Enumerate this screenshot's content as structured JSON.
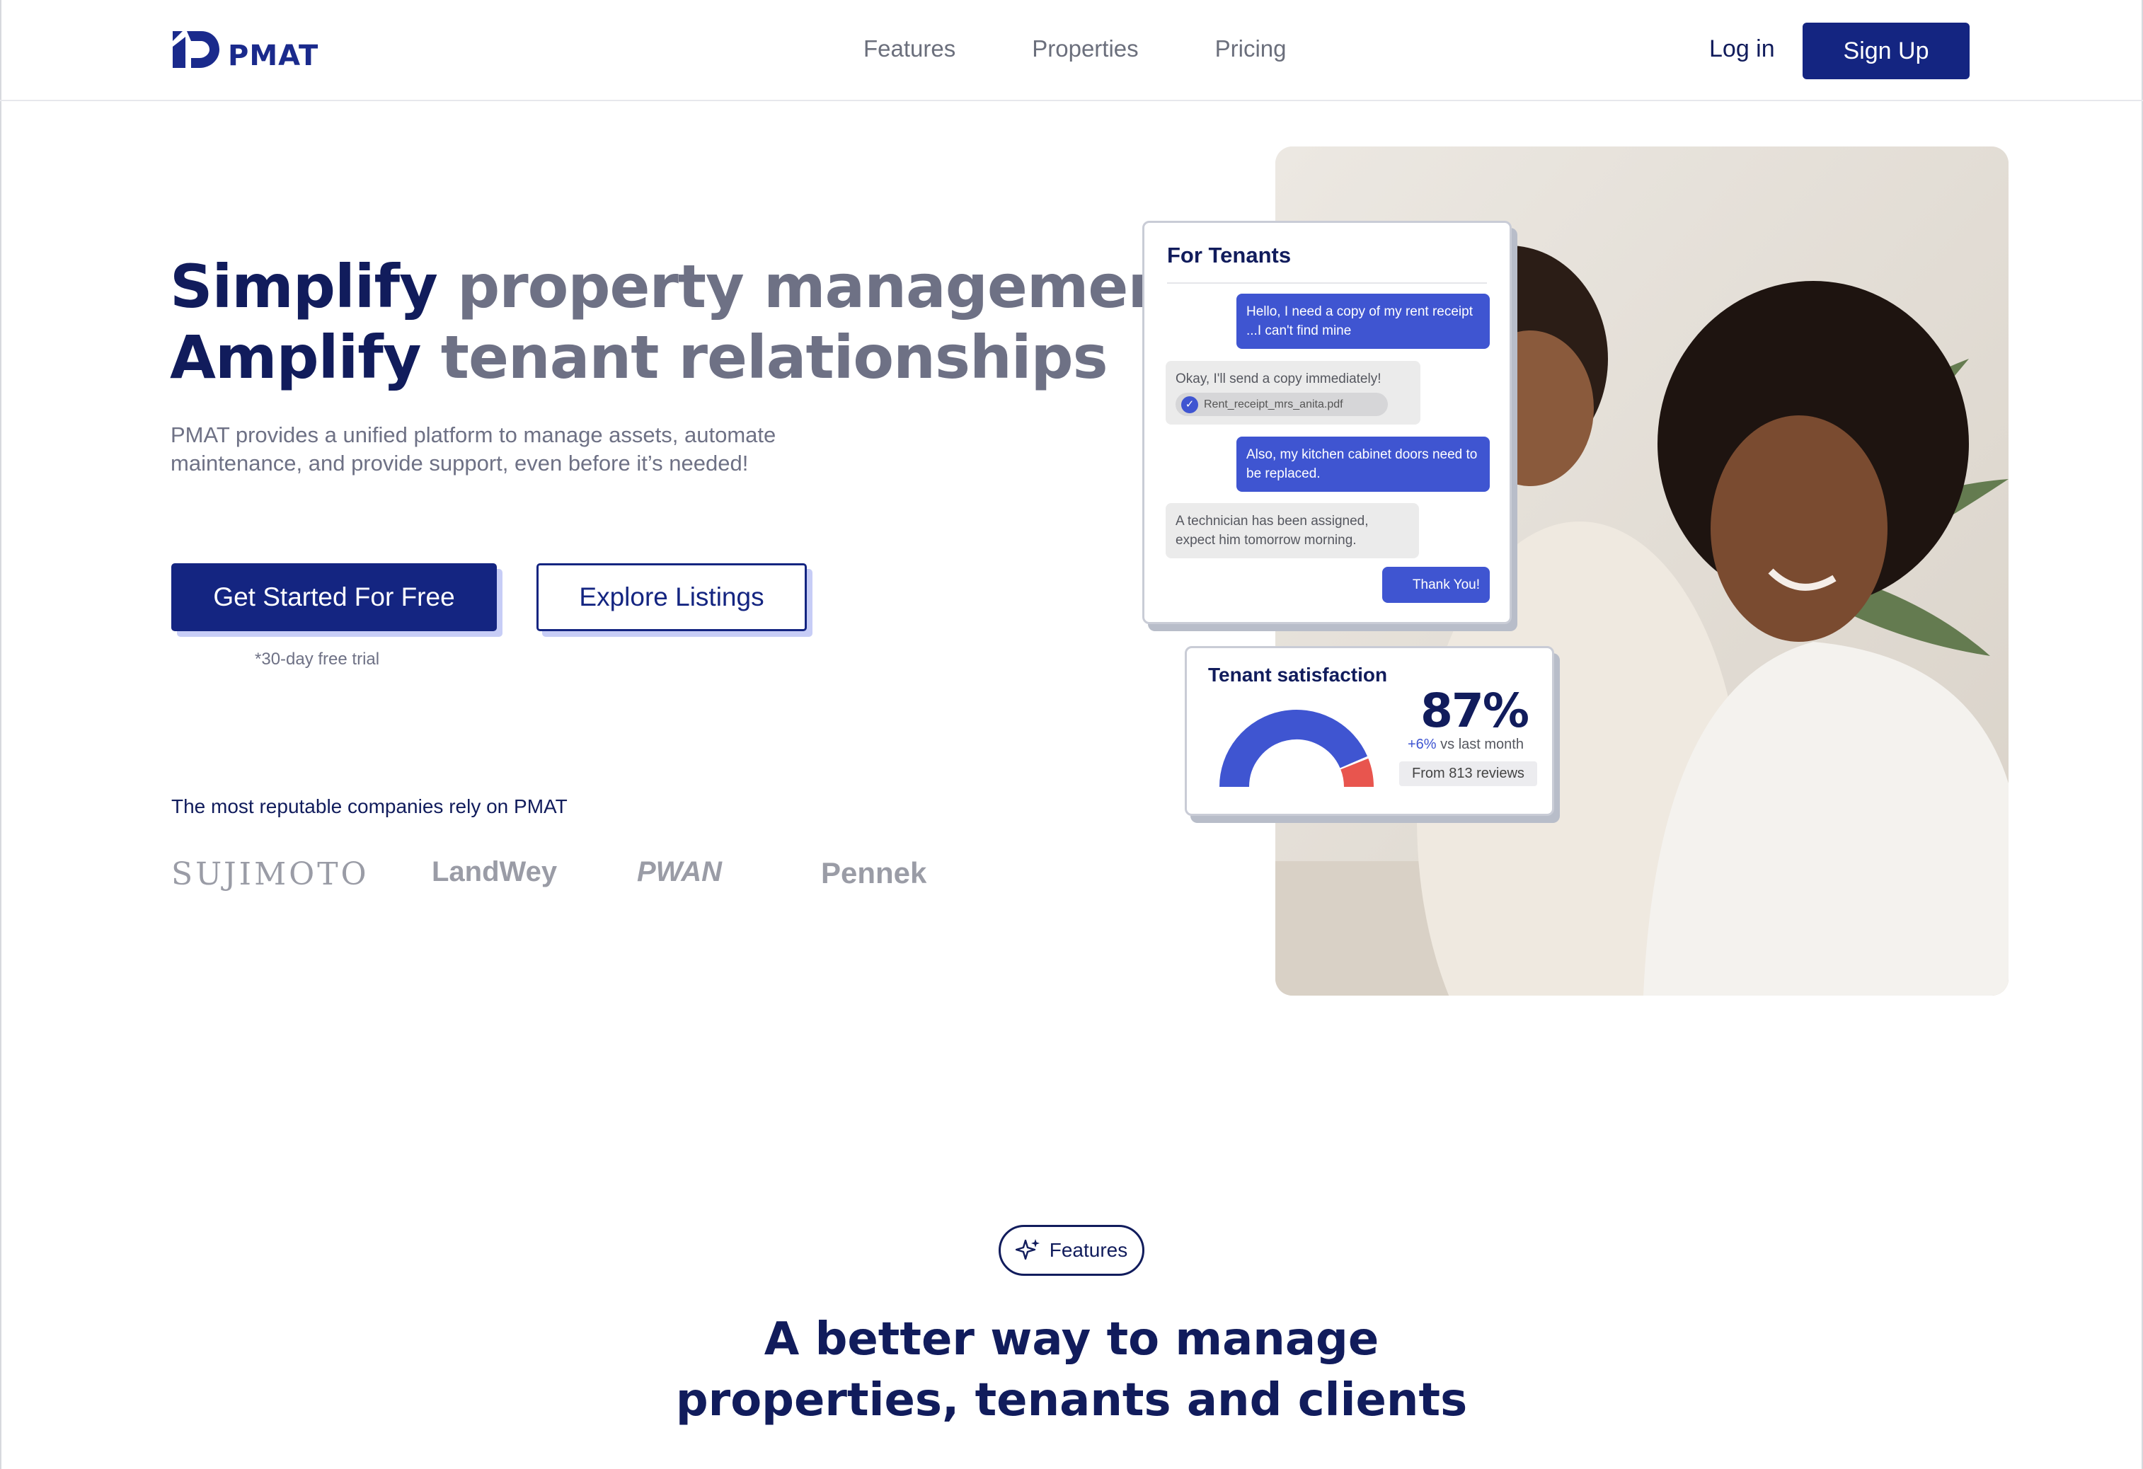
{
  "nav": {
    "logo_text": "PMAT",
    "links": [
      "Features",
      "Properties",
      "Pricing"
    ],
    "login": "Log in",
    "signup": "Sign Up"
  },
  "hero": {
    "title_line1_strong": "Simplify",
    "title_line1_rest": " property management,",
    "title_line2_strong": "Amplify",
    "title_line2_rest": " tenant relationships",
    "description": "PMAT provides a unified platform to manage assets, automate maintenance, and provide support, even before it’s needed!",
    "primary_cta": "Get Started For Free",
    "secondary_cta": "Explore Listings",
    "trial_note": "*30-day free trial"
  },
  "companies": {
    "title": "The most reputable companies rely on PMAT",
    "logos": [
      "SUJIMOTO",
      "LandWey",
      "PWAN",
      "Pennek"
    ]
  },
  "chat": {
    "title": "For Tenants",
    "messages": [
      "Hello, I need a copy of my rent receipt ...I can't find mine",
      "Okay, I'll send a copy immediately!",
      "Also, my kitchen cabinet doors need to be replaced.",
      "A technician has been assigned, expect him tomorrow morning.",
      "Thank You!"
    ],
    "attachment": "Rent_receipt_mrs_anita.pdf"
  },
  "satisfaction": {
    "title": "Tenant satisfaction",
    "value": "87%",
    "value_fraction": 0.87,
    "change": "+6%",
    "change_suffix": " vs last month",
    "reviews": "From 813 reviews",
    "colors": {
      "main": "#3f55d1",
      "remainder": "#e8554e"
    }
  },
  "features": {
    "pill": "Features",
    "heading_line1": "A better way to manage",
    "heading_line2": "properties, tenants and clients"
  }
}
